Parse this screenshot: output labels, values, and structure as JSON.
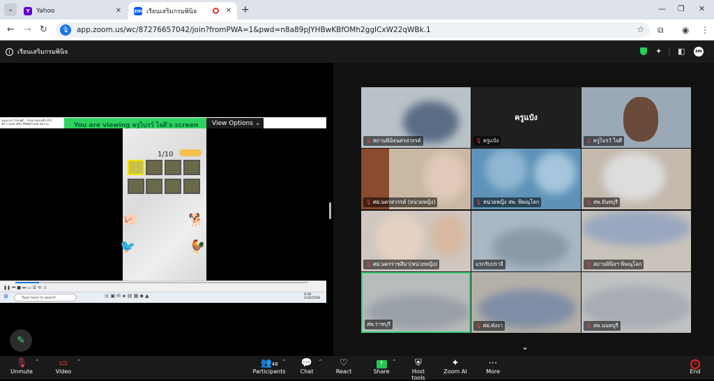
{
  "browser": {
    "tabs": [
      {
        "title": "Yahoo",
        "active": false,
        "favicon_color": "#6001d2",
        "favicon_letter": "Y"
      },
      {
        "title": "เรียนเสริมกรมพินิจ",
        "active": true,
        "favicon_color": "#0b5cff",
        "favicon_letter": "zm"
      }
    ],
    "url": "app.zoom.us/wc/87276657042/join?fromPWA=1&pwd=n8a89pJYHBwKBfOMh2ggICxW22qWBk.1"
  },
  "meeting": {
    "title": "เรียนเสริมกรมพินิจ"
  },
  "share_banner": {
    "viewing_text": "You are viewing  ครูไบรว์ ไจดี's screen",
    "view_options_label": "View Options"
  },
  "shared_screen": {
    "vlc_title": "หนูแมวมาโรงหมูตี - โปรแกรมเล่นสื่อ VLC",
    "vlc_menu": "สื่อ  การเล่น  เสียง  วิดีทัศน์  บรรยายความ",
    "game_counter": "1/10",
    "taskbar_search": "Type here to search",
    "clock_time": "8:48",
    "clock_date": "21/8/2568",
    "playback_progress": 0.08
  },
  "gallery": [
    {
      "name": "สถานพินิจนครสวรรค์",
      "muted": true
    },
    {
      "name": "ครูแป๋ง",
      "muted": true,
      "center_label": "ครูแป๋ง"
    },
    {
      "name": "ครูไบรว์ ไจดี",
      "muted": true
    },
    {
      "name": "ศฝ.นครสวรรค์ (หน่วยหญิง)",
      "muted": true
    },
    {
      "name": "หน่วยหญิง สพ. พิษณุโลก",
      "muted": true
    },
    {
      "name": "สพ.จันทบุรี",
      "muted": true
    },
    {
      "name": "ศฝ.นครราชสีมา(หน่วยหญิง)",
      "muted": true
    },
    {
      "name": "แรกรับปราจี",
      "muted": false
    },
    {
      "name": "สถานพินิจฯ พิษณุโลก",
      "muted": true
    },
    {
      "name": "สพ.ราชบุรี",
      "muted": false
    },
    {
      "name": "ศฝ.พังงา",
      "muted": true
    },
    {
      "name": "สพ.นนทบุรี",
      "muted": true
    }
  ],
  "toolbar": {
    "unmute": "Unmute",
    "video": "Video",
    "participants": "Participants",
    "participants_count": "48",
    "chat": "Chat",
    "react": "React",
    "share": "Share",
    "host_tools": "Host tools",
    "zoom_ai": "Zoom AI",
    "more": "More",
    "end": "End"
  },
  "colors": {
    "banner_green": "#2fd15f",
    "active_speaker": "#3fd17a",
    "end_red": "#e22222",
    "share_green": "#23c552"
  }
}
